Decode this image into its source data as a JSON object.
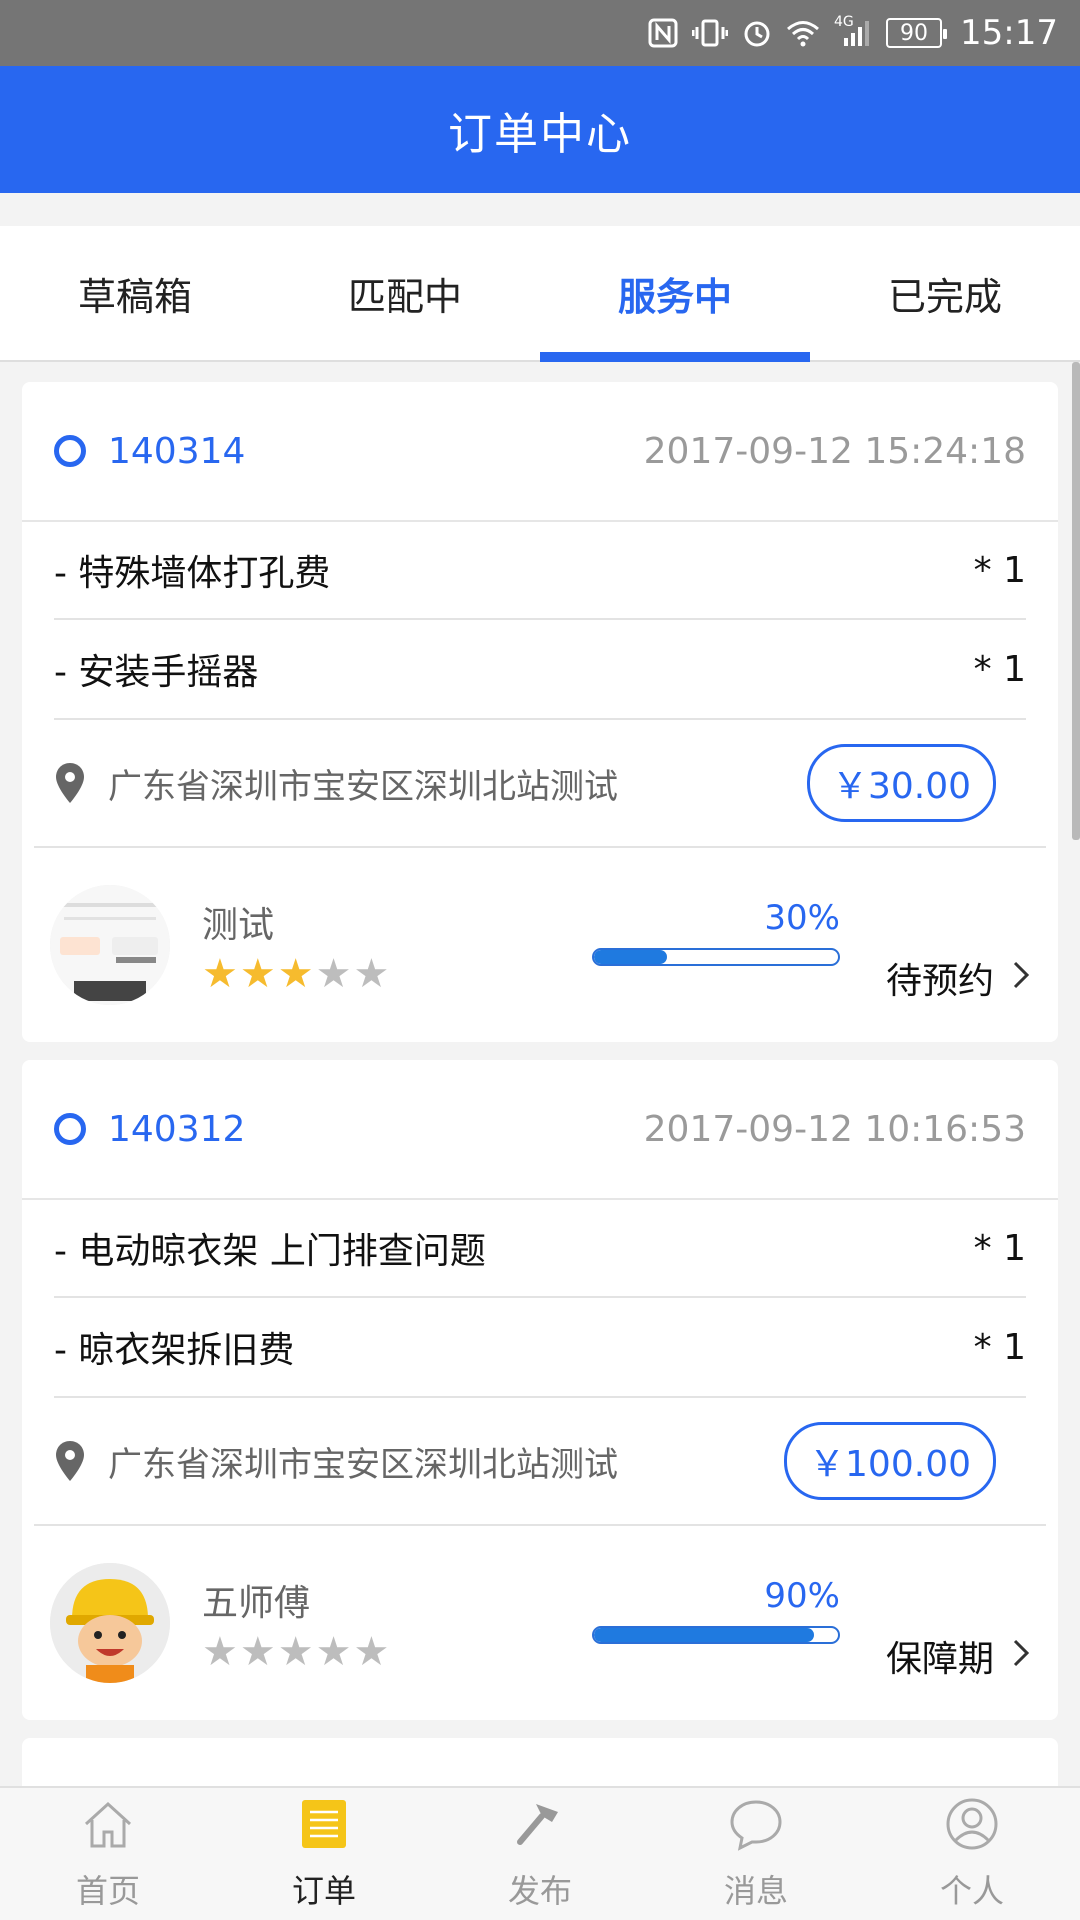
{
  "status_bar": {
    "signal_label": "4G",
    "battery": "90",
    "time": "15:17"
  },
  "app_bar": {
    "title": "订单中心"
  },
  "tabs": [
    {
      "label": "草稿箱",
      "active": false
    },
    {
      "label": "匹配中",
      "active": false
    },
    {
      "label": "服务中",
      "active": true
    },
    {
      "label": "已完成",
      "active": false
    }
  ],
  "orders": [
    {
      "order_no": "140314",
      "time": "2017-09-12 15:24:18",
      "items": [
        {
          "name": "- 特殊墙体打孔费",
          "qty": "* 1"
        },
        {
          "name": "- 安装手摇器",
          "qty": "* 1"
        }
      ],
      "address": "广东省深圳市宝安区深圳北站测试",
      "price": "￥30.00",
      "worker": {
        "name": "测试",
        "rating": 3,
        "avatar": "screenshot-thumbnail"
      },
      "progress": "30%",
      "progress_value": 0.3,
      "status": "待预约"
    },
    {
      "order_no": "140312",
      "time": "2017-09-12 10:16:53",
      "items": [
        {
          "name": "- 电动晾衣架 上门排查问题",
          "qty": "* 1"
        },
        {
          "name": "- 晾衣架拆旧费",
          "qty": "* 1"
        }
      ],
      "address": "广东省深圳市宝安区深圳北站测试",
      "price": "￥100.00",
      "worker": {
        "name": "五师傅",
        "rating": 0,
        "avatar": "worker-cartoon"
      },
      "progress": "90%",
      "progress_value": 0.9,
      "status": "保障期"
    }
  ],
  "bottom_nav": [
    {
      "label": "首页",
      "icon": "home-icon",
      "active": false
    },
    {
      "label": "订单",
      "icon": "orders-icon",
      "active": true
    },
    {
      "label": "发布",
      "icon": "hammer-icon",
      "active": false
    },
    {
      "label": "消息",
      "icon": "message-icon",
      "active": false
    },
    {
      "label": "个人",
      "icon": "profile-icon",
      "active": false
    }
  ],
  "colors": {
    "brand": "#2867f0",
    "star": "#f6bb2e",
    "orders_icon": "#f5c518"
  }
}
